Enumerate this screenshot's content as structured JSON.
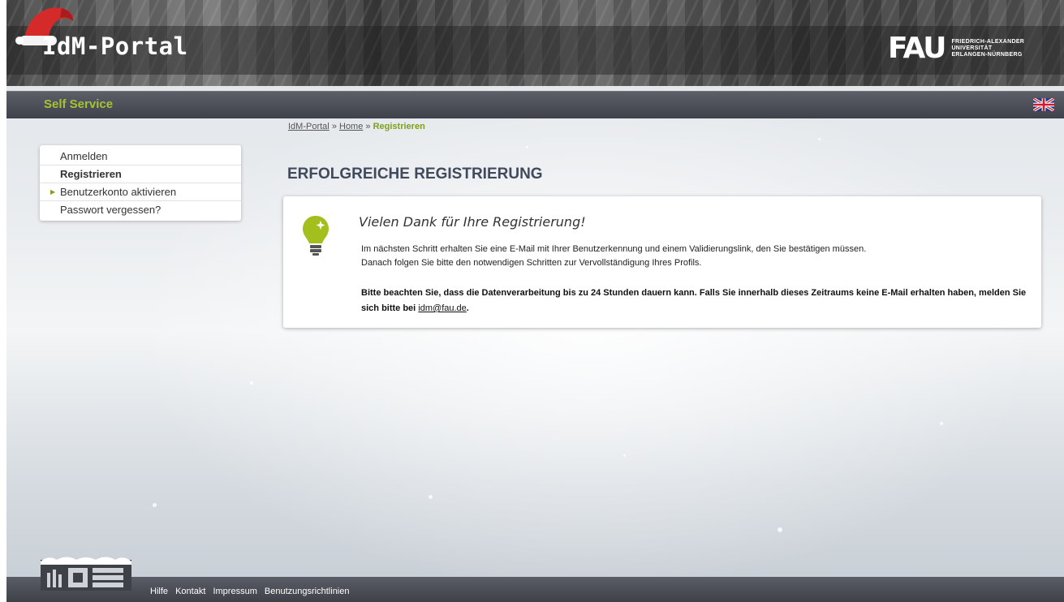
{
  "header": {
    "app_title": "IdM-Portal",
    "university_logo_text": "FAU",
    "university_name_lines": [
      "FRIEDRICH-ALEXANDER",
      "UNIVERSITÄT",
      "ERLANGEN-NÜRNBERG"
    ]
  },
  "navbar": {
    "title": "Self Service",
    "language_flag": "uk-flag-icon"
  },
  "breadcrumb": {
    "items": [
      "IdM-Portal",
      "Home"
    ],
    "separator": "»",
    "current": "Registrieren"
  },
  "sidebar": {
    "items": [
      {
        "label": "Anmelden"
      },
      {
        "label": "Registrieren"
      },
      {
        "label": "Benutzerkonto aktivieren"
      },
      {
        "label": "Passwort vergessen?"
      }
    ]
  },
  "main": {
    "title": "ERFOLGREICHE REGISTRIERUNG",
    "card": {
      "icon": "lightbulb-icon",
      "heading": "Vielen Dank für Ihre Registrierung!",
      "line1": "Im nächsten Schritt erhalten Sie eine E-Mail mit Ihrer Benutzerkennung und einem Validierungslink, den Sie bestätigen müssen.",
      "line2": "Danach folgen Sie bitte den notwendigen Schritten zur Vervollständigung Ihres Profils.",
      "note_part1": "Bitte beachten Sie, dass die Datenverarbeitung bis zu 24 Stunden dauern kann. Falls Sie innerhalb dieses Zeitraums keine E-Mail erhalten haben, melden Sie sich bitte bei",
      "note_email": "idm@fau.de",
      "note_end": "."
    }
  },
  "footer": {
    "links": [
      "Hilfe",
      "Kontakt",
      "Impressum",
      "Benutzungsrichtlinien"
    ]
  },
  "colors": {
    "accent_green": "#a4c531",
    "bar_dark": "#3f424a",
    "title_blue": "#404a5c"
  }
}
